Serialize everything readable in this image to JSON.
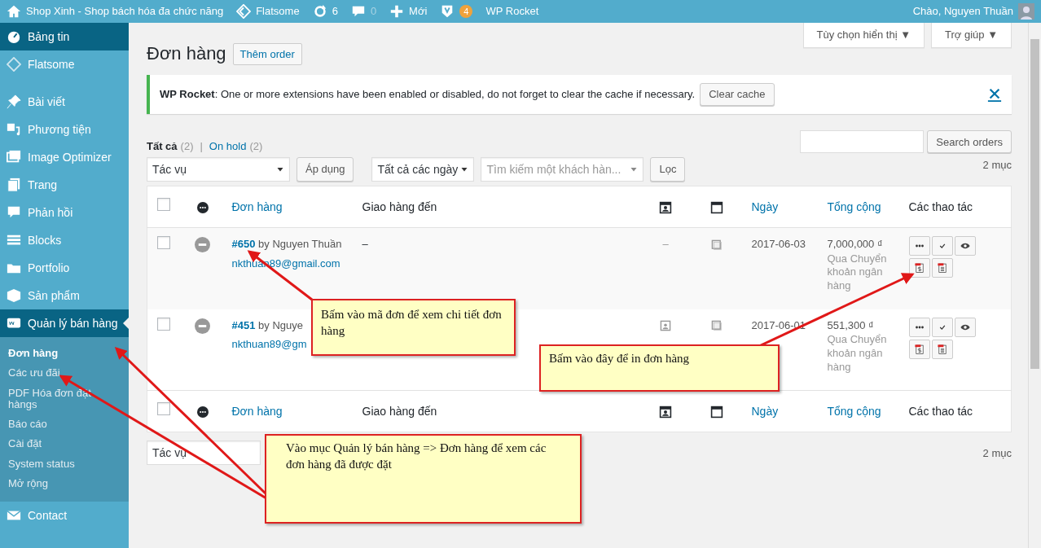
{
  "admin_bar": {
    "items": [
      {
        "label": "Shop Xinh - Shop bách hóa đa chức năng"
      },
      {
        "label": "Flatsome"
      },
      {
        "label": "6"
      },
      {
        "label": "0"
      },
      {
        "label": "Mới"
      },
      {
        "badge": "4"
      },
      {
        "label": "WP Rocket"
      }
    ],
    "greeting": "Chào, Nguyen Thuần"
  },
  "sidebar": {
    "groups": [
      [
        {
          "label": "Bảng tin",
          "selected": true
        },
        {
          "label": "Flatsome",
          "selected": false
        }
      ],
      [
        {
          "label": "Bài viết",
          "selected": false
        },
        {
          "label": "Phương tiện",
          "selected": false
        },
        {
          "label": "Image Optimizer",
          "selected": false
        },
        {
          "label": "Trang",
          "selected": false
        },
        {
          "label": "Phản hồi",
          "selected": false
        },
        {
          "label": "Blocks",
          "selected": false
        },
        {
          "label": "Portfolio",
          "selected": false
        },
        {
          "label": "Sản phẩm",
          "selected": false
        },
        {
          "label": "Quản lý bán hàng",
          "selected": true,
          "current": true,
          "children": [
            {
              "label": "Đơn hàng",
              "selected": true
            },
            {
              "label": "Các ưu đãi",
              "selected": false
            },
            {
              "label": "PDF Hóa đơn đặt hàngs",
              "selected": false
            },
            {
              "label": "Báo cáo",
              "selected": false
            },
            {
              "label": "Cài đặt",
              "selected": false
            },
            {
              "label": "System status",
              "selected": false
            },
            {
              "label": "Mở rộng",
              "selected": false
            }
          ]
        },
        {
          "label": "Contact",
          "selected": false
        }
      ]
    ]
  },
  "screen_tabs": [
    "Tùy chọn hiển thị ▼",
    "Trợ giúp ▼"
  ],
  "page_title": "Đơn hàng",
  "add_button": "Thêm order",
  "notice": {
    "text": "**WP Rocket**: One or more extensions have been enabled or disabled, do not forget to clear the cache if necessary.",
    "button": "Clear cache"
  },
  "views": [
    {
      "label": "Tất cả",
      "count": "(2)",
      "selected": true
    },
    {
      "label": "On hold",
      "count": "(2)",
      "selected": false
    }
  ],
  "views_separator": "|",
  "search_button": "Search orders",
  "top_nav": {
    "bulk": "Tác vụ",
    "apply": "Áp dụng",
    "dates": "Tất cả các ngày",
    "customer_placeholder": "Tìm kiếm một khách hàn...",
    "filter": "Lọc",
    "count": "2 mục"
  },
  "columns": [
    {
      "kind": "check",
      "checked": false
    },
    {
      "kind": "status"
    },
    {
      "kind": "text",
      "label": "Đơn hàng",
      "link": true
    },
    {
      "kind": "text",
      "label": "Giao hàng đến",
      "link": false
    },
    {
      "kind": "billing"
    },
    {
      "kind": "shipping"
    },
    {
      "kind": "text",
      "label": "Ngày",
      "link": true
    },
    {
      "kind": "text",
      "label": "Tổng cộng",
      "link": true
    },
    {
      "kind": "text",
      "label": "Các thao tác",
      "link": false
    }
  ],
  "rows": [
    {
      "selected": false,
      "order": "#650",
      "customer": "by Nguyen Thuần",
      "email": "nkthuan89@gmail.com",
      "ship_to": "–",
      "billing_text": "–",
      "date": "2017-06-03",
      "total": "7,000,000 ₫",
      "payment": "Qua Chuyển khoản ngân hàng"
    },
    {
      "selected": false,
      "order": "#451",
      "customer": "by Nguye",
      "email": "nkthuan89@gm",
      "billing_icon": true,
      "date": "2017-06-01",
      "total": "551,300 ₫",
      "payment": "Qua Chuyển khoản ngân hàng"
    }
  ],
  "footer_columns": [
    {
      "kind": "check",
      "checked": false
    },
    {
      "kind": "status"
    },
    {
      "kind": "text",
      "label": "Đơn hàng",
      "link": true
    },
    {
      "kind": "text",
      "label": "Giao hàng đến",
      "link": false
    },
    {
      "kind": "billing"
    },
    {
      "kind": "shipping"
    },
    {
      "kind": "text",
      "label": "Ngày",
      "link": true
    },
    {
      "kind": "text",
      "label": "Tổng cộng",
      "link": true
    },
    {
      "kind": "text",
      "label": "Các thao tác",
      "link": false
    }
  ],
  "bottom_nav": {
    "bulk": "Tác vụ",
    "count": "2 mục"
  },
  "callouts": [
    "Bấm vào mã đơn để xem chi tiết đơn hàng",
    "Bấm vào đây để in đơn hàng",
    "Vào mục Quản lý bán hàng => Đơn hàng để xem các đơn hàng đã được đặt"
  ]
}
